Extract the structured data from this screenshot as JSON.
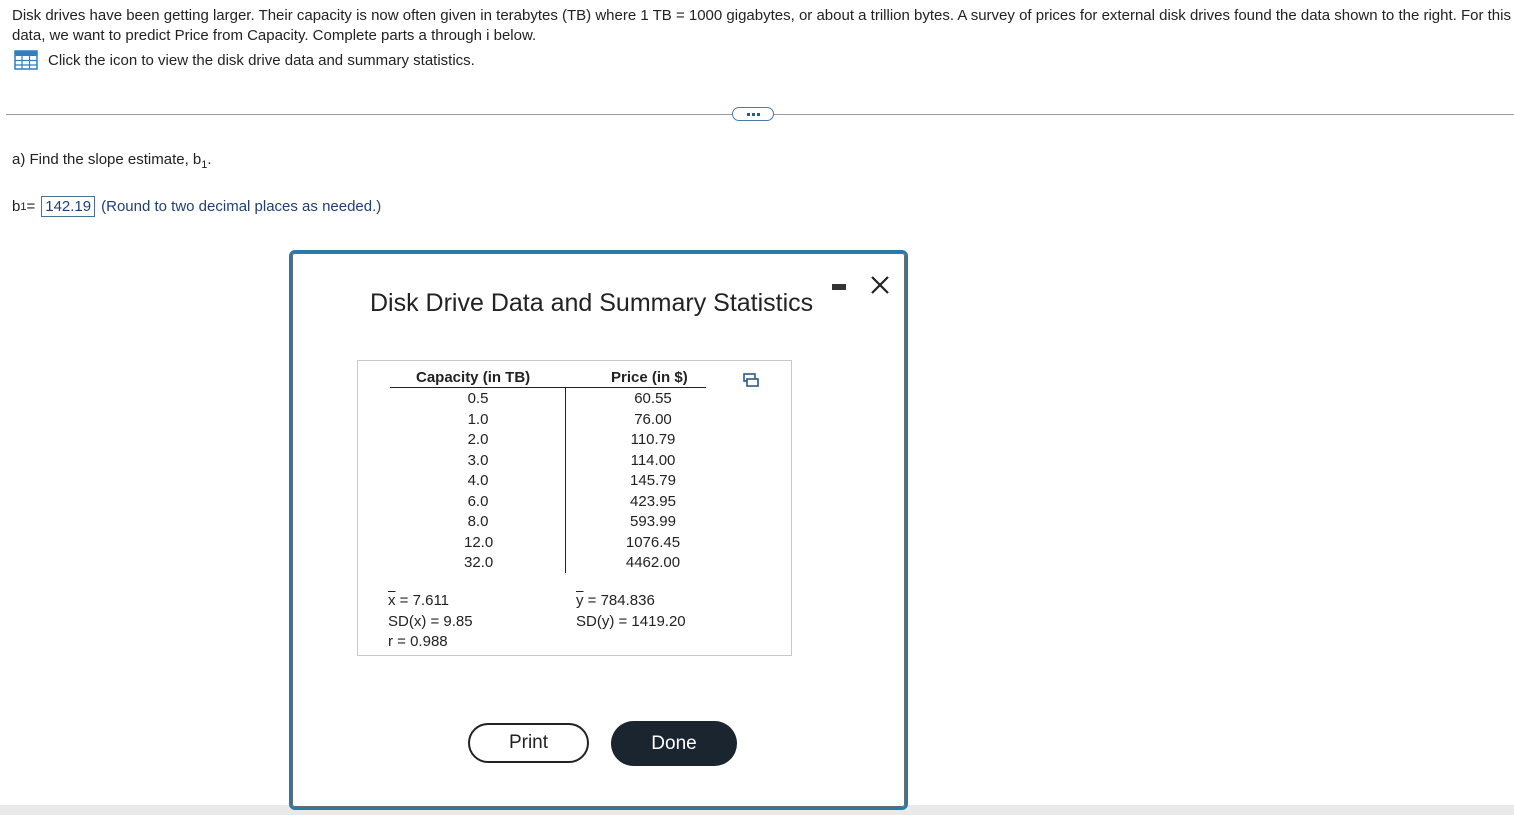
{
  "intro": {
    "text": "Disk drives have been getting larger. Their capacity is now often given in terabytes (TB) where 1 TB = 1000 gigabytes, or about a trillion bytes. A survey of prices for external disk drives found the data shown to the right. For this data, we want to predict Price from Capacity. Complete parts a through i below.",
    "icon_link_text": "Click the icon to view the disk drive data and summary statistics."
  },
  "question_a": {
    "text": "a) Find the slope estimate, b",
    "sub": "1",
    "end": ".",
    "answer_label": "b",
    "answer_sub": "1",
    "equals": " =",
    "answer_value": "142.19",
    "hint": "(Round to two decimal places as needed.)"
  },
  "more_button_icon": "ellipsis-icon",
  "modal": {
    "title": "Disk Drive Data and Summary Statistics",
    "table": {
      "headers": [
        "Capacity (in TB)",
        "Price (in $)"
      ],
      "capacity": [
        "0.5",
        "1.0",
        "2.0",
        "3.0",
        "4.0",
        "6.0",
        "8.0",
        "12.0",
        "32.0"
      ],
      "price": [
        "60.55",
        "76.00",
        "110.79",
        "114.00",
        "145.79",
        "423.95",
        "593.99",
        "1076.45",
        "4462.00"
      ]
    },
    "stats": {
      "xbar_symbol": "x",
      "xbar_value": " = 7.611",
      "sdx": "SD(x) = 9.85",
      "r": "r = 0.988",
      "ybar_symbol": "y",
      "ybar_value": " = 784.836",
      "sdy": "SD(y) = 1419.20"
    },
    "print_label": "Print",
    "done_label": "Done"
  },
  "colors": {
    "modal_border": "#2d78a6",
    "answer_text": "#1f3f75",
    "done_button": "#1b2530"
  }
}
